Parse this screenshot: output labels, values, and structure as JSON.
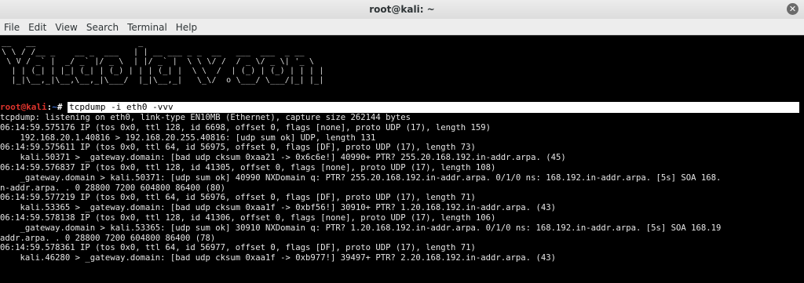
{
  "window": {
    "title": "root@kali: ~"
  },
  "menu": [
    "File",
    "Edit",
    "View",
    "Search",
    "Terminal",
    "Help"
  ],
  "banner": [
    "__   __                     _                                 ",
    "\\ \\ / /__ _    __ _  ___   | | __ ___ _ _  __   ___  ___  _ __",
    " \\ V / _` |  _/ _` |/ _ \\  | |/ _` |  \\ \\ \\/ /  / _ \\/ _ \\| '_ \\",
    "  | | (_| | |_| (_| | (_) | | | (_| |  \\ \\  /  | (_) | (_) | | | |",
    "  |_|\\__,_|\\__,\\__,_|\\___/  |_|\\__,_|   \\_\\/  o \\___/ \\___/|_| |_|"
  ],
  "prompt": {
    "user_host": "root@kali",
    "separator": ":",
    "path": "~",
    "symbol": "# ",
    "command": "tcpdump -i eth0 -vvv"
  },
  "output": [
    "tcpdump: listening on eth0, link-type EN10MB (Ethernet), capture size 262144 bytes",
    "06:14:59.575176 IP (tos 0x0, ttl 128, id 6698, offset 0, flags [none], proto UDP (17), length 159)",
    "    192.168.20.1.40816 > 192.168.20.255.40816: [udp sum ok] UDP, length 131",
    "06:14:59.575611 IP (tos 0x0, ttl 64, id 56975, offset 0, flags [DF], proto UDP (17), length 73)",
    "    kali.50371 > _gateway.domain: [bad udp cksum 0xaa21 -> 0x6c6e!] 40990+ PTR? 255.20.168.192.in-addr.arpa. (45)",
    "06:14:59.576837 IP (tos 0x0, ttl 128, id 41305, offset 0, flags [none], proto UDP (17), length 108)",
    "    _gateway.domain > kali.50371: [udp sum ok] 40990 NXDomain q: PTR? 255.20.168.192.in-addr.arpa. 0/1/0 ns: 168.192.in-addr.arpa. [5s] SOA 168.",
    "n-addr.arpa. . 0 28800 7200 604800 86400 (80)",
    "06:14:59.577219 IP (tos 0x0, ttl 64, id 56976, offset 0, flags [DF], proto UDP (17), length 71)",
    "    kali.53365 > _gateway.domain: [bad udp cksum 0xaa1f -> 0xbf56!] 30910+ PTR? 1.20.168.192.in-addr.arpa. (43)",
    "06:14:59.578138 IP (tos 0x0, ttl 128, id 41306, offset 0, flags [none], proto UDP (17), length 106)",
    "    _gateway.domain > kali.53365: [udp sum ok] 30910 NXDomain q: PTR? 1.20.168.192.in-addr.arpa. 0/1/0 ns: 168.192.in-addr.arpa. [5s] SOA 168.19",
    "addr.arpa. . 0 28800 7200 604800 86400 (78)",
    "06:14:59.578361 IP (tos 0x0, ttl 64, id 56977, offset 0, flags [DF], proto UDP (17), length 71)",
    "    kali.46280 > _gateway.domain: [bad udp cksum 0xaa1f -> 0xb977!] 39497+ PTR? 2.20.168.192.in-addr.arpa. (43)"
  ]
}
